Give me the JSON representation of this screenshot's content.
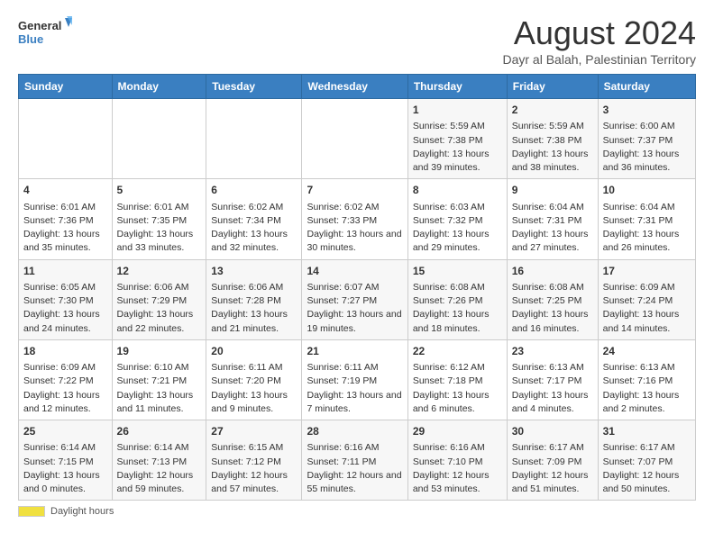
{
  "logo": {
    "text_general": "General",
    "text_blue": "Blue"
  },
  "title": "August 2024",
  "subtitle": "Dayr al Balah, Palestinian Territory",
  "days_of_week": [
    "Sunday",
    "Monday",
    "Tuesday",
    "Wednesday",
    "Thursday",
    "Friday",
    "Saturday"
  ],
  "footer": {
    "daylight_label": "Daylight hours"
  },
  "weeks": [
    [
      {
        "day": "",
        "sunrise": "",
        "sunset": "",
        "daylight": ""
      },
      {
        "day": "",
        "sunrise": "",
        "sunset": "",
        "daylight": ""
      },
      {
        "day": "",
        "sunrise": "",
        "sunset": "",
        "daylight": ""
      },
      {
        "day": "",
        "sunrise": "",
        "sunset": "",
        "daylight": ""
      },
      {
        "day": "1",
        "sunrise": "Sunrise: 5:59 AM",
        "sunset": "Sunset: 7:38 PM",
        "daylight": "Daylight: 13 hours and 39 minutes."
      },
      {
        "day": "2",
        "sunrise": "Sunrise: 5:59 AM",
        "sunset": "Sunset: 7:38 PM",
        "daylight": "Daylight: 13 hours and 38 minutes."
      },
      {
        "day": "3",
        "sunrise": "Sunrise: 6:00 AM",
        "sunset": "Sunset: 7:37 PM",
        "daylight": "Daylight: 13 hours and 36 minutes."
      }
    ],
    [
      {
        "day": "4",
        "sunrise": "Sunrise: 6:01 AM",
        "sunset": "Sunset: 7:36 PM",
        "daylight": "Daylight: 13 hours and 35 minutes."
      },
      {
        "day": "5",
        "sunrise": "Sunrise: 6:01 AM",
        "sunset": "Sunset: 7:35 PM",
        "daylight": "Daylight: 13 hours and 33 minutes."
      },
      {
        "day": "6",
        "sunrise": "Sunrise: 6:02 AM",
        "sunset": "Sunset: 7:34 PM",
        "daylight": "Daylight: 13 hours and 32 minutes."
      },
      {
        "day": "7",
        "sunrise": "Sunrise: 6:02 AM",
        "sunset": "Sunset: 7:33 PM",
        "daylight": "Daylight: 13 hours and 30 minutes."
      },
      {
        "day": "8",
        "sunrise": "Sunrise: 6:03 AM",
        "sunset": "Sunset: 7:32 PM",
        "daylight": "Daylight: 13 hours and 29 minutes."
      },
      {
        "day": "9",
        "sunrise": "Sunrise: 6:04 AM",
        "sunset": "Sunset: 7:31 PM",
        "daylight": "Daylight: 13 hours and 27 minutes."
      },
      {
        "day": "10",
        "sunrise": "Sunrise: 6:04 AM",
        "sunset": "Sunset: 7:31 PM",
        "daylight": "Daylight: 13 hours and 26 minutes."
      }
    ],
    [
      {
        "day": "11",
        "sunrise": "Sunrise: 6:05 AM",
        "sunset": "Sunset: 7:30 PM",
        "daylight": "Daylight: 13 hours and 24 minutes."
      },
      {
        "day": "12",
        "sunrise": "Sunrise: 6:06 AM",
        "sunset": "Sunset: 7:29 PM",
        "daylight": "Daylight: 13 hours and 22 minutes."
      },
      {
        "day": "13",
        "sunrise": "Sunrise: 6:06 AM",
        "sunset": "Sunset: 7:28 PM",
        "daylight": "Daylight: 13 hours and 21 minutes."
      },
      {
        "day": "14",
        "sunrise": "Sunrise: 6:07 AM",
        "sunset": "Sunset: 7:27 PM",
        "daylight": "Daylight: 13 hours and 19 minutes."
      },
      {
        "day": "15",
        "sunrise": "Sunrise: 6:08 AM",
        "sunset": "Sunset: 7:26 PM",
        "daylight": "Daylight: 13 hours and 18 minutes."
      },
      {
        "day": "16",
        "sunrise": "Sunrise: 6:08 AM",
        "sunset": "Sunset: 7:25 PM",
        "daylight": "Daylight: 13 hours and 16 minutes."
      },
      {
        "day": "17",
        "sunrise": "Sunrise: 6:09 AM",
        "sunset": "Sunset: 7:24 PM",
        "daylight": "Daylight: 13 hours and 14 minutes."
      }
    ],
    [
      {
        "day": "18",
        "sunrise": "Sunrise: 6:09 AM",
        "sunset": "Sunset: 7:22 PM",
        "daylight": "Daylight: 13 hours and 12 minutes."
      },
      {
        "day": "19",
        "sunrise": "Sunrise: 6:10 AM",
        "sunset": "Sunset: 7:21 PM",
        "daylight": "Daylight: 13 hours and 11 minutes."
      },
      {
        "day": "20",
        "sunrise": "Sunrise: 6:11 AM",
        "sunset": "Sunset: 7:20 PM",
        "daylight": "Daylight: 13 hours and 9 minutes."
      },
      {
        "day": "21",
        "sunrise": "Sunrise: 6:11 AM",
        "sunset": "Sunset: 7:19 PM",
        "daylight": "Daylight: 13 hours and 7 minutes."
      },
      {
        "day": "22",
        "sunrise": "Sunrise: 6:12 AM",
        "sunset": "Sunset: 7:18 PM",
        "daylight": "Daylight: 13 hours and 6 minutes."
      },
      {
        "day": "23",
        "sunrise": "Sunrise: 6:13 AM",
        "sunset": "Sunset: 7:17 PM",
        "daylight": "Daylight: 13 hours and 4 minutes."
      },
      {
        "day": "24",
        "sunrise": "Sunrise: 6:13 AM",
        "sunset": "Sunset: 7:16 PM",
        "daylight": "Daylight: 13 hours and 2 minutes."
      }
    ],
    [
      {
        "day": "25",
        "sunrise": "Sunrise: 6:14 AM",
        "sunset": "Sunset: 7:15 PM",
        "daylight": "Daylight: 13 hours and 0 minutes."
      },
      {
        "day": "26",
        "sunrise": "Sunrise: 6:14 AM",
        "sunset": "Sunset: 7:13 PM",
        "daylight": "Daylight: 12 hours and 59 minutes."
      },
      {
        "day": "27",
        "sunrise": "Sunrise: 6:15 AM",
        "sunset": "Sunset: 7:12 PM",
        "daylight": "Daylight: 12 hours and 57 minutes."
      },
      {
        "day": "28",
        "sunrise": "Sunrise: 6:16 AM",
        "sunset": "Sunset: 7:11 PM",
        "daylight": "Daylight: 12 hours and 55 minutes."
      },
      {
        "day": "29",
        "sunrise": "Sunrise: 6:16 AM",
        "sunset": "Sunset: 7:10 PM",
        "daylight": "Daylight: 12 hours and 53 minutes."
      },
      {
        "day": "30",
        "sunrise": "Sunrise: 6:17 AM",
        "sunset": "Sunset: 7:09 PM",
        "daylight": "Daylight: 12 hours and 51 minutes."
      },
      {
        "day": "31",
        "sunrise": "Sunrise: 6:17 AM",
        "sunset": "Sunset: 7:07 PM",
        "daylight": "Daylight: 12 hours and 50 minutes."
      }
    ]
  ]
}
